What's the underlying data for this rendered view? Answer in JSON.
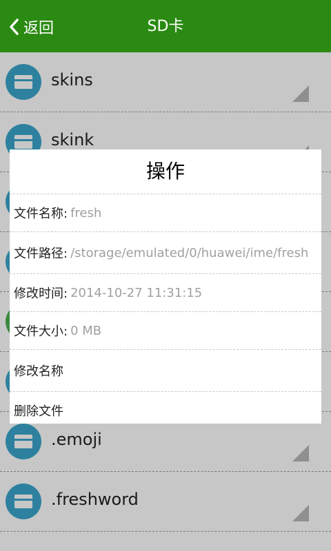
{
  "header": {
    "back_label": "返回",
    "title": "SD卡",
    "color": "#2b8a12"
  },
  "list": {
    "items": [
      {
        "name": "skins",
        "icon": "card-icon"
      },
      {
        "name": "skink",
        "icon": "card-icon"
      },
      {
        "name": "",
        "icon": "card-icon"
      },
      {
        "name": "",
        "icon": "card-icon"
      },
      {
        "name": "",
        "icon": "card-icon"
      },
      {
        "name": "",
        "icon": "card-icon"
      },
      {
        "name": ".emoji",
        "icon": "card-icon"
      },
      {
        "name": ".freshword",
        "icon": "card-icon"
      }
    ]
  },
  "dialog": {
    "title": "操作",
    "name_label": "文件名称:",
    "name_value": "fresh",
    "path_label": "文件路径:",
    "path_value": "/storage/emulated/0/huawei/ime/fresh",
    "time_label": "修改时间:",
    "time_value": "2014-10-27 11:31:15",
    "size_label": "文件大小:",
    "size_value": "0 MB",
    "rename_label": "修改名称",
    "delete_label": "删除文件"
  }
}
